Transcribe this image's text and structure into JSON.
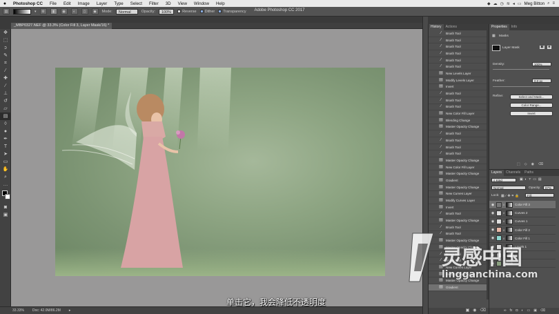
{
  "menubar": {
    "apple": "",
    "app": "Photoshop CC",
    "items": [
      "File",
      "Edit",
      "Image",
      "Layer",
      "Type",
      "Select",
      "Filter",
      "3D",
      "View",
      "Window",
      "Help"
    ],
    "user": "Meg Bitton"
  },
  "window": {
    "title": "Adobe Photoshop CC 2017"
  },
  "options": {
    "mode_label": "Mode:",
    "mode": "Normal",
    "opacity_label": "Opacity:",
    "opacity": "100%",
    "reverse": "Reverse",
    "dither": "Dither",
    "transparency": "Transparency"
  },
  "document": {
    "tab": "_MBP0327.NEF @ 33.3% (Color Fill 3, Layer Mask/16) *"
  },
  "status": {
    "zoom": "33.33%",
    "doc": "Doc: 42.0M/86.2M"
  },
  "subtitle": "单击它，我会降低不透明度",
  "history": {
    "tabs": [
      "History",
      "Actions"
    ],
    "items": [
      {
        "label": "Brush Tool",
        "icon": "brush"
      },
      {
        "label": "Brush Tool",
        "icon": "brush"
      },
      {
        "label": "Brush Tool",
        "icon": "brush"
      },
      {
        "label": "Brush Tool",
        "icon": "brush"
      },
      {
        "label": "Brush Tool",
        "icon": "brush"
      },
      {
        "label": "Brush Tool",
        "icon": "brush"
      },
      {
        "label": "New Levels Layer",
        "icon": "doc"
      },
      {
        "label": "Modify Levels Layer",
        "icon": "doc"
      },
      {
        "label": "Invert",
        "icon": "doc"
      },
      {
        "label": "Brush Tool",
        "icon": "brush"
      },
      {
        "label": "Brush Tool",
        "icon": "brush"
      },
      {
        "label": "Brush Tool",
        "icon": "brush"
      },
      {
        "label": "New Color Fill Layer",
        "icon": "doc"
      },
      {
        "label": "Blending Change",
        "icon": "doc"
      },
      {
        "label": "Master Opacity Change",
        "icon": "doc"
      },
      {
        "label": "Brush Tool",
        "icon": "brush"
      },
      {
        "label": "Brush Tool",
        "icon": "brush"
      },
      {
        "label": "Brush Tool",
        "icon": "brush"
      },
      {
        "label": "Brush Tool",
        "icon": "brush"
      },
      {
        "label": "Master Opacity Change",
        "icon": "doc"
      },
      {
        "label": "New Color Fill Layer",
        "icon": "doc"
      },
      {
        "label": "Master Opacity Change",
        "icon": "doc"
      },
      {
        "label": "Gradient",
        "icon": "doc"
      },
      {
        "label": "Master Opacity Change",
        "icon": "doc"
      },
      {
        "label": "New Curves Layer",
        "icon": "doc"
      },
      {
        "label": "Modify Curves Layer",
        "icon": "doc"
      },
      {
        "label": "Invert",
        "icon": "doc"
      },
      {
        "label": "Brush Tool",
        "icon": "brush"
      },
      {
        "label": "Master Opacity Change",
        "icon": "doc"
      },
      {
        "label": "Brush Tool",
        "icon": "brush"
      },
      {
        "label": "Brush Tool",
        "icon": "brush"
      },
      {
        "label": "Master Opacity Change",
        "icon": "doc"
      },
      {
        "label": "Master Opacity Change",
        "icon": "doc"
      },
      {
        "label": "Brush Tool",
        "icon": "brush"
      },
      {
        "label": "Brush Tool",
        "icon": "brush"
      },
      {
        "label": "New Curves Layer",
        "icon": "doc"
      },
      {
        "label": "Modify Curves Layer",
        "icon": "doc"
      },
      {
        "label": "Master Opacity Change",
        "icon": "doc"
      },
      {
        "label": "Gradient",
        "icon": "doc",
        "selected": true
      }
    ]
  },
  "properties": {
    "tabs": [
      "Properties",
      "Info"
    ],
    "section": "Masks",
    "mask_label": "Layer Mask",
    "density_label": "Density:",
    "density": "100%",
    "feather_label": "Feather:",
    "feather": "0.0 px",
    "refine_label": "Refine:",
    "btn_select_mask": "Select and Mask...",
    "btn_color_range": "Color Range...",
    "btn_invert": "Invert"
  },
  "layers": {
    "tabs": [
      "Layers",
      "Channels",
      "Paths"
    ],
    "kind": "Kind",
    "blend": "Normal",
    "opacity_label": "Opacity:",
    "opacity": "87%",
    "lock_label": "Lock:",
    "fill_label": "Fill:",
    "items": [
      {
        "name": "Color Fill 3",
        "swatch": "#7a7a7a",
        "mask": "#111",
        "selected": true
      },
      {
        "name": "Curves 2",
        "swatch": "#dddddd",
        "mask": "#222"
      },
      {
        "name": "Curves 1",
        "swatch": "#dddddd",
        "mask": "#222"
      },
      {
        "name": "Color Fill 2",
        "swatch": "#e8b8a8",
        "mask": "#151515"
      },
      {
        "name": "Color Fill 1",
        "swatch": "#8fd7d0",
        "mask": "#1a1a1a"
      },
      {
        "name": "Levels 1",
        "swatch": "#dddddd",
        "mask": "#202020"
      },
      {
        "name": "",
        "swatch": "#cccccc",
        "mask": "#444"
      },
      {
        "name": "Back",
        "swatch": "#8aa080",
        "mask": ""
      }
    ]
  },
  "watermark": {
    "cn": "灵感中国",
    "url": "lingganchina.com"
  }
}
